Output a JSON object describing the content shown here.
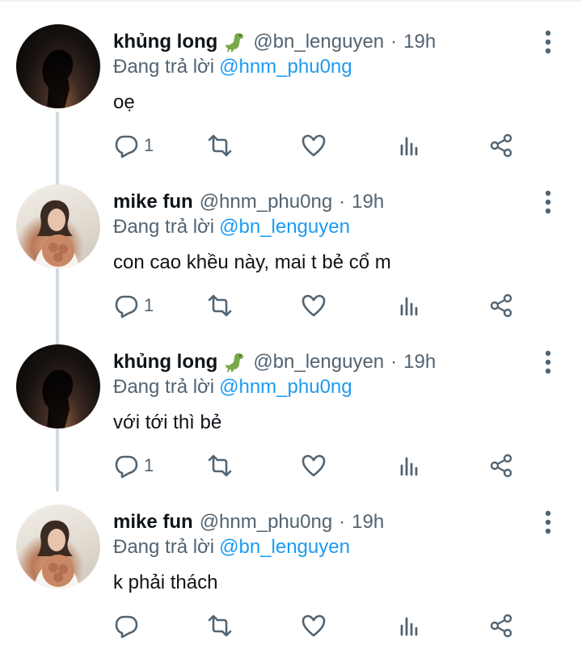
{
  "colors": {
    "text": "#0f1419",
    "secondary": "#536471",
    "link": "#1d9bf0",
    "thread_line": "#cfd9de"
  },
  "icons": {
    "reply": "comment-icon",
    "retweet": "retweet-icon",
    "like": "heart-icon",
    "views": "bar-chart-icon",
    "share": "share-icon",
    "more": "vertical-dots-icon",
    "emoji": "dinosaur-emoji-icon"
  },
  "tweets": [
    {
      "name": "khủng long",
      "has_emoji": true,
      "handle": "@bn_lenguyen",
      "sep": "·",
      "time": "19h",
      "reply_label": "Đang trả lời",
      "reply_to": "@hnm_phu0ng",
      "text": "oẹ",
      "reply_count": "1"
    },
    {
      "name": "mike fun",
      "has_emoji": false,
      "handle": "@hnm_phu0ng",
      "sep": "·",
      "time": "19h",
      "reply_label": "Đang trả lời",
      "reply_to": "@bn_lenguyen",
      "text": "con cao khều này, mai t bẻ cổ m",
      "reply_count": "1"
    },
    {
      "name": "khủng long",
      "has_emoji": true,
      "handle": "@bn_lenguyen",
      "sep": "·",
      "time": "19h",
      "reply_label": "Đang trả lời",
      "reply_to": "@hnm_phu0ng",
      "text": "với tới thì bẻ",
      "reply_count": "1"
    },
    {
      "name": "mike fun",
      "has_emoji": false,
      "handle": "@hnm_phu0ng",
      "sep": "·",
      "time": "19h",
      "reply_label": "Đang trả lời",
      "reply_to": "@bn_lenguyen",
      "text": "k phải thách",
      "reply_count": ""
    }
  ]
}
